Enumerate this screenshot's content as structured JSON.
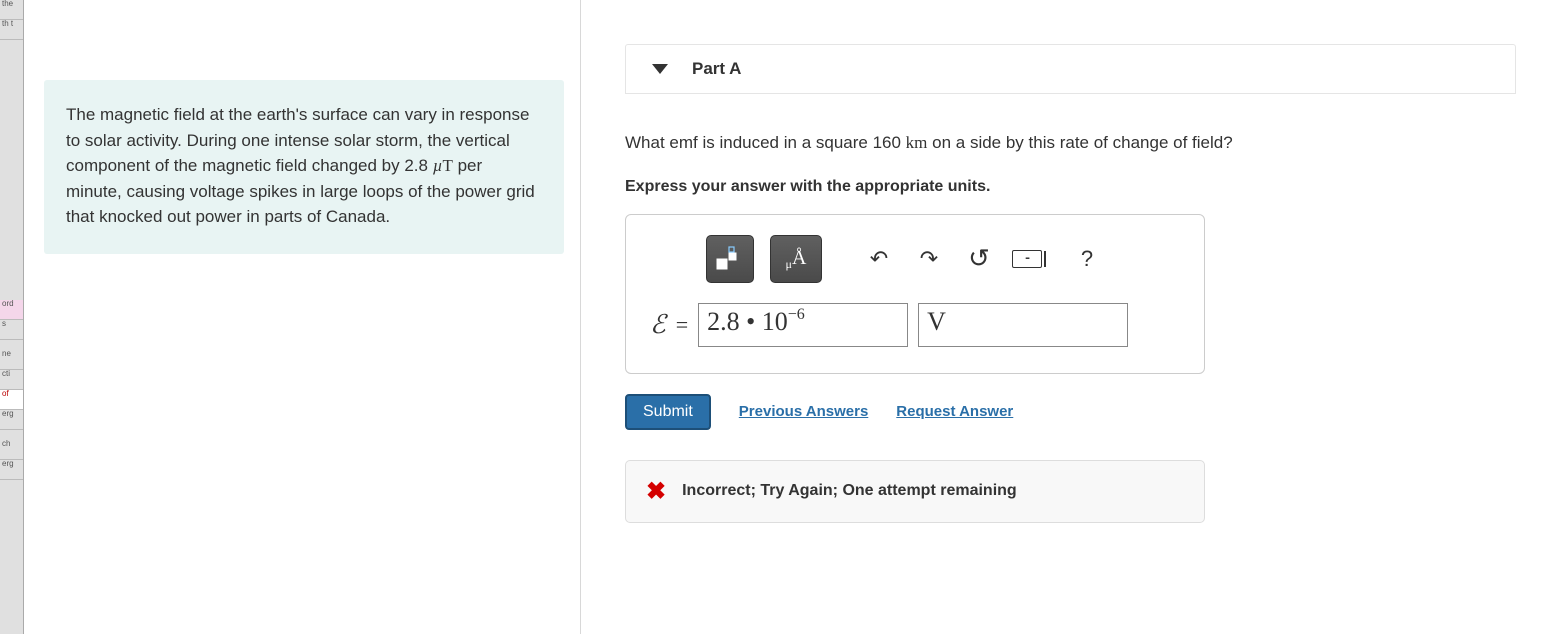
{
  "problem_text": "The magnetic field at the earth's surface can vary in response to solar activity. During one intense solar storm, the vertical component of the magnetic field changed by 2.8 µT per minute, causing voltage spikes in large loops of the power grid that knocked out power in parts of Canada.",
  "part": {
    "label": "Part A",
    "question_prefix": "What emf is induced in a square 160 ",
    "question_unit": "km",
    "question_suffix": " on a side by this rate of change of field?",
    "instructions": "Express your answer with the appropriate units."
  },
  "answer": {
    "symbol": "ℰ",
    "equals": "=",
    "value_display": "2.8 • 10⁻⁶",
    "value_base": "2.8 • 10",
    "value_exp": "−6",
    "unit": "V"
  },
  "toolbar": {
    "template_icon": "template-icon",
    "subscript_icon": "μÅ",
    "undo": "↶",
    "redo": "↷",
    "reset": "↻",
    "keyboard": "⌨",
    "help": "?"
  },
  "actions": {
    "submit": "Submit",
    "previous": "Previous Answers",
    "request": "Request Answer"
  },
  "feedback": {
    "icon": "✖",
    "message": "Incorrect; Try Again; One attempt remaining"
  },
  "tabs": [
    "the",
    "th t",
    "",
    "ord",
    "s",
    "ne",
    "cti",
    "of",
    "erg",
    "ch",
    "erg"
  ]
}
